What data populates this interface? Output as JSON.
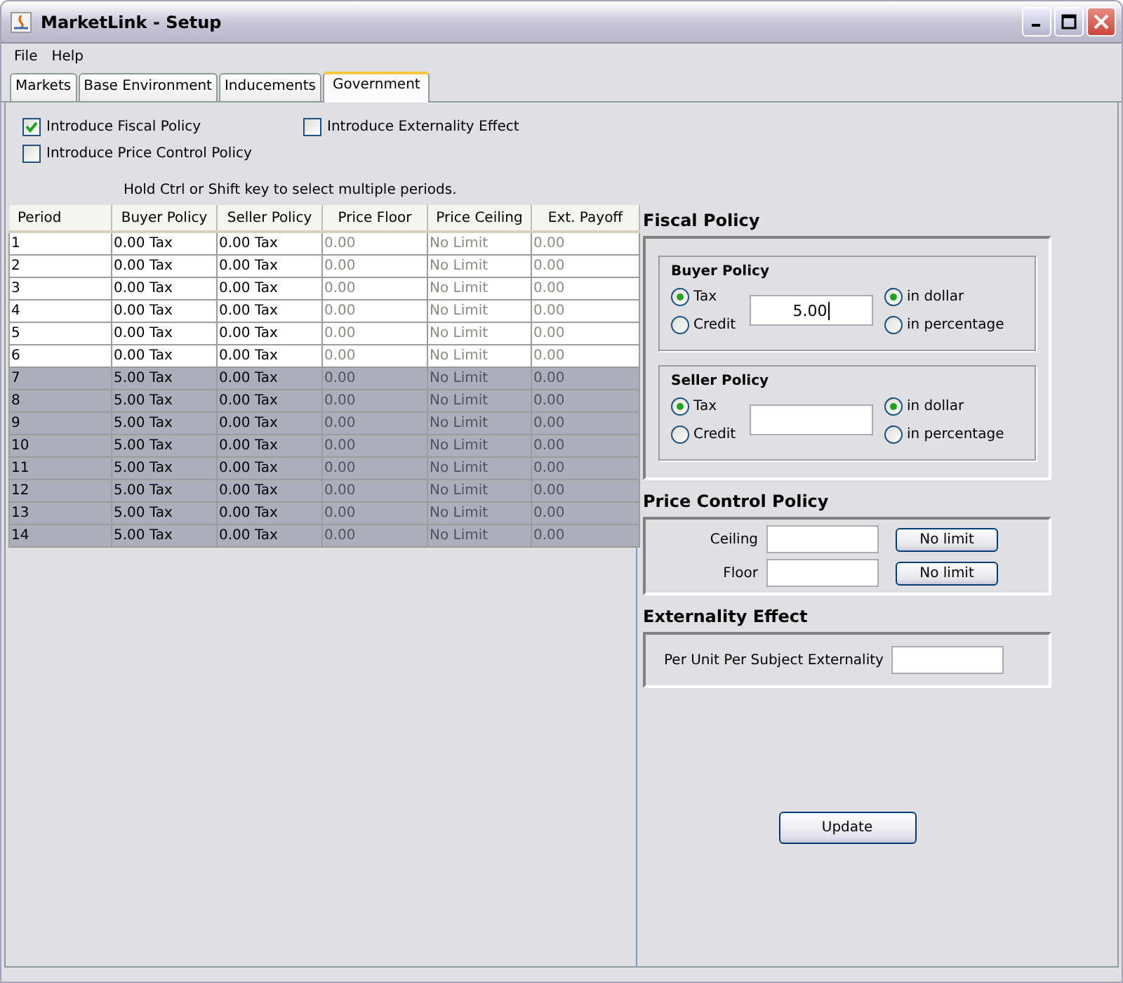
{
  "window": {
    "title": "MarketLink - Setup"
  },
  "menu": [
    {
      "label": "File"
    },
    {
      "label": "Help"
    }
  ],
  "tabs": [
    {
      "label": "Markets",
      "selected": false
    },
    {
      "label": "Base Environment",
      "selected": false
    },
    {
      "label": "Inducements",
      "selected": false
    },
    {
      "label": "Government",
      "selected": true
    }
  ],
  "options": [
    {
      "label": "Introduce Fiscal Policy",
      "checked": true
    },
    {
      "label": "Introduce Externality Effect",
      "checked": false
    },
    {
      "label": "Introduce Price Control Policy",
      "checked": false
    }
  ],
  "hint": "Hold Ctrl or Shift key to select multiple periods.",
  "table": {
    "columns": [
      {
        "label": "Period",
        "disabled": false
      },
      {
        "label": "Buyer Policy",
        "disabled": false
      },
      {
        "label": "Seller Policy",
        "disabled": false
      },
      {
        "label": "Price Floor",
        "disabled": true
      },
      {
        "label": "Price Ceiling",
        "disabled": true
      },
      {
        "label": "Ext. Payoff",
        "disabled": true
      }
    ],
    "rows": [
      {
        "cells": [
          "1",
          "0.00 Tax",
          "0.00 Tax",
          "0.00",
          "No Limit",
          "0.00"
        ],
        "selected": false
      },
      {
        "cells": [
          "2",
          "0.00 Tax",
          "0.00 Tax",
          "0.00",
          "No Limit",
          "0.00"
        ],
        "selected": false
      },
      {
        "cells": [
          "3",
          "0.00 Tax",
          "0.00 Tax",
          "0.00",
          "No Limit",
          "0.00"
        ],
        "selected": false
      },
      {
        "cells": [
          "4",
          "0.00 Tax",
          "0.00 Tax",
          "0.00",
          "No Limit",
          "0.00"
        ],
        "selected": false
      },
      {
        "cells": [
          "5",
          "0.00 Tax",
          "0.00 Tax",
          "0.00",
          "No Limit",
          "0.00"
        ],
        "selected": false
      },
      {
        "cells": [
          "6",
          "0.00 Tax",
          "0.00 Tax",
          "0.00",
          "No Limit",
          "0.00"
        ],
        "selected": false
      },
      {
        "cells": [
          "7",
          "5.00 Tax",
          "0.00 Tax",
          "0.00",
          "No Limit",
          "0.00"
        ],
        "selected": true
      },
      {
        "cells": [
          "8",
          "5.00 Tax",
          "0.00 Tax",
          "0.00",
          "No Limit",
          "0.00"
        ],
        "selected": true
      },
      {
        "cells": [
          "9",
          "5.00 Tax",
          "0.00 Tax",
          "0.00",
          "No Limit",
          "0.00"
        ],
        "selected": true
      },
      {
        "cells": [
          "10",
          "5.00 Tax",
          "0.00 Tax",
          "0.00",
          "No Limit",
          "0.00"
        ],
        "selected": true
      },
      {
        "cells": [
          "11",
          "5.00 Tax",
          "0.00 Tax",
          "0.00",
          "No Limit",
          "0.00"
        ],
        "selected": true
      },
      {
        "cells": [
          "12",
          "5.00 Tax",
          "0.00 Tax",
          "0.00",
          "No Limit",
          "0.00"
        ],
        "selected": true
      },
      {
        "cells": [
          "13",
          "5.00 Tax",
          "0.00 Tax",
          "0.00",
          "No Limit",
          "0.00"
        ],
        "selected": true
      },
      {
        "cells": [
          "14",
          "5.00 Tax",
          "0.00 Tax",
          "0.00",
          "No Limit",
          "0.00"
        ],
        "selected": true
      }
    ]
  },
  "fiscal_policy": {
    "title": "Fiscal Policy",
    "groups": [
      {
        "title": "Buyer Policy",
        "type_options": [
          {
            "label": "Tax",
            "selected": true
          },
          {
            "label": "Credit",
            "selected": false
          }
        ],
        "value": "5.00",
        "unit_options": [
          {
            "label": "in dollar",
            "selected": true
          },
          {
            "label": "in percentage",
            "selected": false
          }
        ]
      },
      {
        "title": "Seller Policy",
        "type_options": [
          {
            "label": "Tax",
            "selected": true
          },
          {
            "label": "Credit",
            "selected": false
          }
        ],
        "unit_options": [
          {
            "label": "in dollar",
            "selected": true
          },
          {
            "label": "in percentage",
            "selected": false
          }
        ]
      }
    ]
  },
  "price_control": {
    "title": "Price Control Policy",
    "rows": [
      {
        "label": "Ceiling",
        "button": "No limit"
      },
      {
        "label": "Floor",
        "button": "No limit"
      }
    ]
  },
  "externality": {
    "title": "Externality Effect",
    "label": "Per Unit Per Subject Externality"
  },
  "update_button": "Update"
}
